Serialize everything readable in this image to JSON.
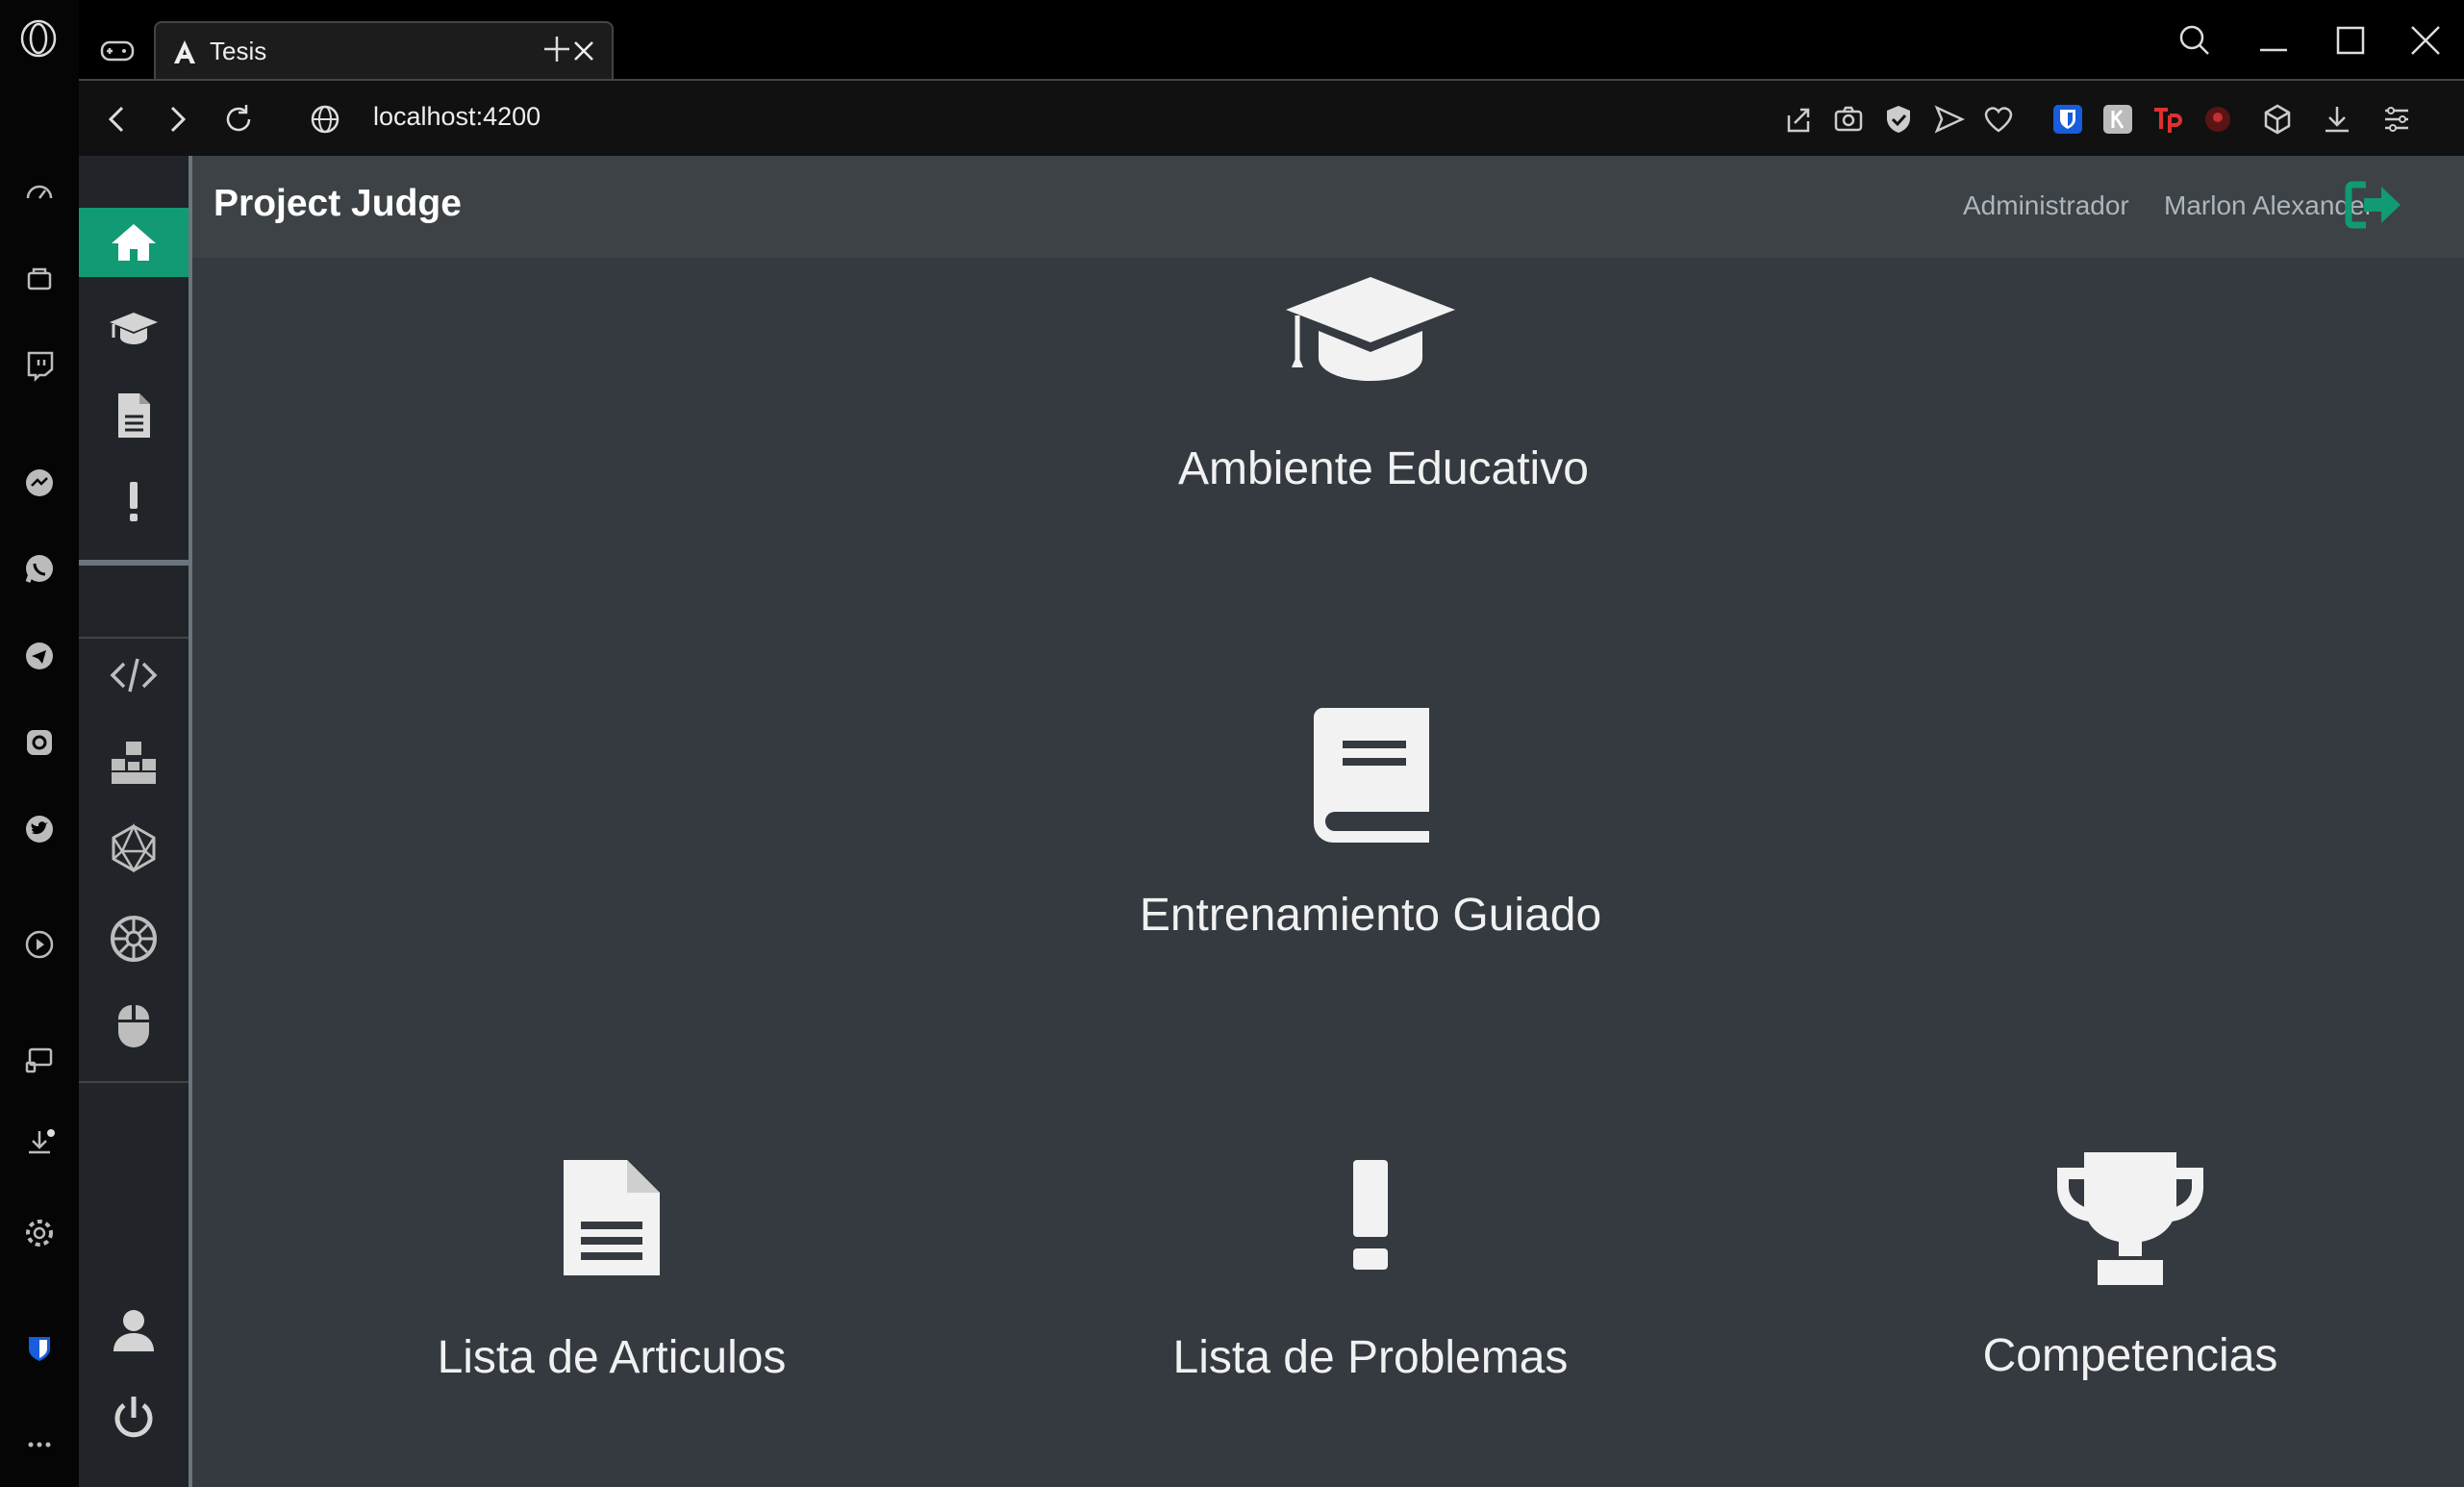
{
  "browser": {
    "tab_title": "Tesis",
    "url": "localhost:4200"
  },
  "header": {
    "brand": "Project Judge",
    "role": "Administrador",
    "user_name": "Marlon Alexander"
  },
  "main": {
    "cards": [
      {
        "label": "Ambiente Educativo",
        "icon": "graduation-cap-icon"
      },
      {
        "label": "Entrenamiento Guiado",
        "icon": "book-icon"
      },
      {
        "label": "Lista de Articulos",
        "icon": "document-icon"
      },
      {
        "label": "Lista de Problemas",
        "icon": "exclamation-icon"
      },
      {
        "label": "Competencias",
        "icon": "trophy-icon"
      }
    ]
  },
  "colors": {
    "accent": "#119a74",
    "sidebar": "#212529",
    "background": "#343a40",
    "topbar": "#3c4245"
  }
}
